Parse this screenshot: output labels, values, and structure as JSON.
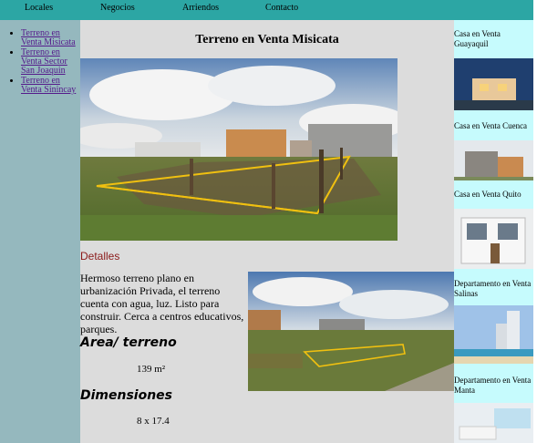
{
  "nav": {
    "items": [
      "Locales",
      "Negocios",
      "Arriendos",
      "Contacto"
    ]
  },
  "sidebar": {
    "links": [
      "Terreno en Venta Misicata",
      "Terreno en Venta Sector San Joaquin",
      "Terreno en Venta Sinincay"
    ]
  },
  "main": {
    "title": "Terreno en Venta Misicata",
    "section_title": "Detalles",
    "description": "Hermoso terreno plano en urbanización Privada, el terreno cuenta con agua, luz. Listo para construir. Cerca a centros educativos, parques.",
    "area_heading": "Area/ terreno",
    "area_value": "139 m²",
    "dimensions_heading": "Dimensiones",
    "dimensions_value": "8 x 17.4"
  },
  "related": {
    "items": [
      "Casa en Venta Guayaquil",
      "Casa en Venta Cuenca",
      "Casa en Venta Quito",
      "Departamento en Venta Salinas",
      "Departamento en Venta Manta"
    ]
  },
  "colors": {
    "nav": "#2ca6a4",
    "left_sidebar": "#95b8be",
    "main_bg": "#dcdcdc",
    "right_sidebar": "#c6fbfd",
    "section_title": "#8b1a1a",
    "plot_outline": "#f0c010"
  }
}
